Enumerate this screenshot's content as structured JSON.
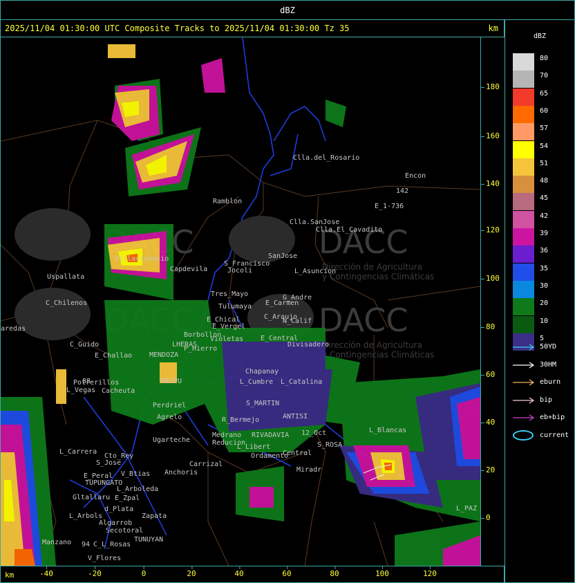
{
  "header": {
    "title": "dBZ"
  },
  "subheader": {
    "title": "2025/11/04 01:30:00 UTC Composite Tracks to 2025/11/04 01:30:00 Tz 35",
    "unit": "km"
  },
  "axes": {
    "x_unit": "km",
    "x_ticks": [
      "-40",
      "-20",
      "0",
      "20",
      "40",
      "60",
      "80",
      "100",
      "120"
    ],
    "y_ticks": [
      "180",
      "160",
      "140",
      "120",
      "100",
      "80",
      "60",
      "40",
      "20",
      "0"
    ]
  },
  "legend": {
    "title": "dBZ",
    "levels": [
      {
        "label": "80",
        "color": "#d9d9d9"
      },
      {
        "label": "70",
        "color": "#b5b5b5"
      },
      {
        "label": "65",
        "color": "#f23a2a"
      },
      {
        "label": "60",
        "color": "#ff6a00"
      },
      {
        "label": "57",
        "color": "#ff9a66"
      },
      {
        "label": "54",
        "color": "#ffff00"
      },
      {
        "label": "51",
        "color": "#f5c43a"
      },
      {
        "label": "48",
        "color": "#d7903c"
      },
      {
        "label": "45",
        "color": "#b86a7e"
      },
      {
        "label": "42",
        "color": "#d052a0"
      },
      {
        "label": "39",
        "color": "#cc14a0"
      },
      {
        "label": "36",
        "color": "#6a1ed0"
      },
      {
        "label": "35",
        "color": "#1f4ee8"
      },
      {
        "label": "30",
        "color": "#0a88e0"
      },
      {
        "label": "20",
        "color": "#0e7a1a"
      },
      {
        "label": "10",
        "color": "#0b5a12"
      },
      {
        "label": "5",
        "color": "#3a2e86"
      }
    ],
    "tracks": [
      {
        "label": "50YD",
        "color": "#38d0f5"
      },
      {
        "label": "30HM",
        "color": "#ffffff"
      },
      {
        "label": "eburn",
        "color": "#f5b55a"
      },
      {
        "label": "bip",
        "color": "#f5c8d8"
      },
      {
        "label": "eb+bip",
        "color": "#d040d0"
      }
    ],
    "current": {
      "label": "current",
      "color": "#38d0f5"
    }
  },
  "watermark": {
    "logo_text": "DACC",
    "line1": "Dirección de Agricultura",
    "line2": "y Contingencias Climáticas"
  },
  "places": [
    {
      "name": "Clla.del_Rosario"
    },
    {
      "name": "Encon"
    },
    {
      "name": "142"
    },
    {
      "name": "E_1-736"
    },
    {
      "name": "Ramblon"
    },
    {
      "name": "Clla.SanJose"
    },
    {
      "name": "Clla.El_Cavadito"
    },
    {
      "name": "S_Francisco"
    },
    {
      "name": "Jocoli"
    },
    {
      "name": "SanJose"
    },
    {
      "name": "L_Asuncion"
    },
    {
      "name": "Uspallata"
    },
    {
      "name": "Villavicencio"
    },
    {
      "name": "Capdevila"
    },
    {
      "name": "Tres_Mayo"
    },
    {
      "name": "Tulumaya"
    },
    {
      "name": "G_Andre"
    },
    {
      "name": "E_Carmen"
    },
    {
      "name": "C_Chilenos"
    },
    {
      "name": "E_Chical"
    },
    {
      "name": "E_Vergel"
    },
    {
      "name": "C_Araujo"
    },
    {
      "name": "N_Calif"
    },
    {
      "name": "aredas"
    },
    {
      "name": "Borbollon"
    },
    {
      "name": "Violetas"
    },
    {
      "name": "E_Central"
    },
    {
      "name": "Divisadero"
    },
    {
      "name": "C_Guido"
    },
    {
      "name": "P_Hierro"
    },
    {
      "name": "E_Challao"
    },
    {
      "name": "LHERAS"
    },
    {
      "name": "MENDOZA"
    },
    {
      "name": "Chapanay"
    },
    {
      "name": "L_Cumbre"
    },
    {
      "name": "L_Catalina"
    },
    {
      "name": "Potrerillos"
    },
    {
      "name": "Cacheuta"
    },
    {
      "name": "L_Vegas"
    },
    {
      "name": "MAIPU"
    },
    {
      "name": "Perdriel"
    },
    {
      "name": "S_MARTIN"
    },
    {
      "name": "Agrelo"
    },
    {
      "name": "R_Bermejo"
    },
    {
      "name": "ANTISI"
    },
    {
      "name": "12_Oct"
    },
    {
      "name": "L_Blancas"
    },
    {
      "name": "Ugarteche"
    },
    {
      "name": "Medrano"
    },
    {
      "name": "Reducion"
    },
    {
      "name": "RIVADAVIA"
    },
    {
      "name": "L_Libert"
    },
    {
      "name": "S_ROSA"
    },
    {
      "name": "L_Carrera"
    },
    {
      "name": "Cto_Rey"
    },
    {
      "name": "S_Jose"
    },
    {
      "name": "Carrizal"
    },
    {
      "name": "Ordamento"
    },
    {
      "name": "Central"
    },
    {
      "name": "E_Peral"
    },
    {
      "name": "V_Btias"
    },
    {
      "name": "Anchoris"
    },
    {
      "name": "TUPUNGATO"
    },
    {
      "name": "L_Arboleda"
    },
    {
      "name": "Miradr"
    },
    {
      "name": "Gltallaru"
    },
    {
      "name": "E_Zpal"
    },
    {
      "name": "d_Plata"
    },
    {
      "name": "L_Arbols"
    },
    {
      "name": "Zapata"
    },
    {
      "name": "Algarrob"
    },
    {
      "name": "Secotoral"
    },
    {
      "name": "TUNUYAN"
    },
    {
      "name": "Manzano"
    },
    {
      "name": "C_L_Rosas"
    },
    {
      "name": "V_Flores"
    },
    {
      "name": "L_PAZ"
    },
    {
      "name": "94"
    },
    {
      "name": "88"
    }
  ]
}
